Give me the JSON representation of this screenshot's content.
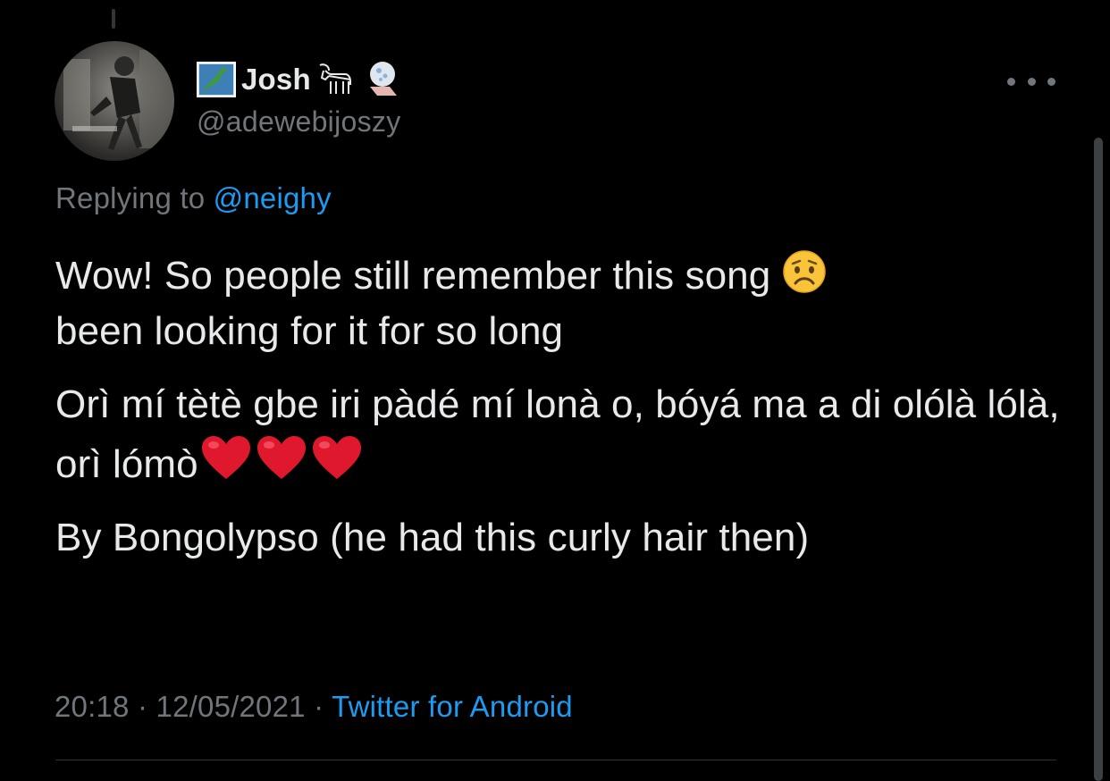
{
  "tweet": {
    "author": {
      "display_name": "Josh",
      "handle": "@adewebijoszy",
      "name_emojis": [
        "japan-map-flag-icon",
        "goat-icon",
        "soap-icon"
      ]
    },
    "replying_prefix": "Replying to",
    "replying_to": "@neighy",
    "paragraphs": {
      "p1_line1": "Wow! So people still remember this song",
      "p1_line2": "been looking for it for so long",
      "p2": "Orì mí tètè gbe iri pàdé mí lonà o, bóyá ma a di olólà lólà, orì lómò",
      "p3": "By Bongolypso (he had this curly hair then)"
    },
    "time": "20:18",
    "separator": "·",
    "date": "12/05/2021",
    "source": "Twitter for Android"
  },
  "colors": {
    "background": "#000000",
    "text": "#e7e9ea",
    "muted": "#71767b",
    "link": "#1d9bf0",
    "heart": "#e0182d"
  }
}
